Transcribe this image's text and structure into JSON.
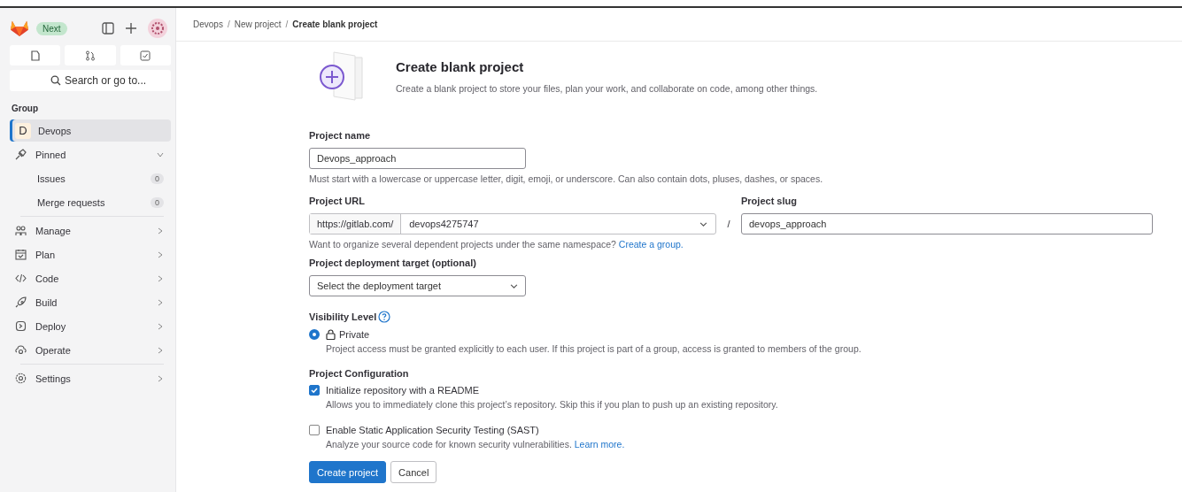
{
  "sidebar": {
    "badge": "Next",
    "search": {
      "placeholder": "Search or go to..."
    },
    "section": "Group",
    "group": {
      "avatar": "D",
      "label": "Devops",
      "selected": true
    },
    "pinned": {
      "label": "Pinned",
      "expanded": true,
      "children": [
        {
          "label": "Issues",
          "count": "0"
        },
        {
          "label": "Merge requests",
          "count": "0"
        }
      ]
    },
    "items": [
      {
        "label": "Manage",
        "selected": false
      },
      {
        "label": "Plan",
        "selected": false
      },
      {
        "label": "Code",
        "selected": false
      },
      {
        "label": "Build",
        "selected": false
      },
      {
        "label": "Deploy",
        "selected": false
      },
      {
        "label": "Operate",
        "selected": false
      },
      {
        "label": "Settings",
        "selected": false
      }
    ]
  },
  "breadcrumb": [
    "Devops",
    "New project",
    "Create blank project"
  ],
  "breadcrumb_separator": "/",
  "header": {
    "title": "Create blank project",
    "description": "Create a blank project to store your files, plan your work, and collaborate on code, among other things."
  },
  "form": {
    "name_label": "Project name",
    "name_value": "Devops_approach",
    "name_help": "Must start with a lowercase or uppercase letter, digit, emoji, or underscore. Can also contain dots, pluses, dashes, or spaces.",
    "url_label": "Project URL",
    "url_prefix": "https://gitlab.com/",
    "namespace": "devops4275747",
    "separator": "/",
    "slug_label": "Project slug",
    "slug_value": "devops_approach",
    "url_help": "Want to organize several dependent projects under the same namespace?",
    "url_link": "Create a group.",
    "target_label": "Project deployment target (optional)",
    "target_value": "Select the deployment target",
    "visibility_label": "Visibility Level",
    "visibility": [
      {
        "label": "Private",
        "description": "Project access must be granted explicitly to each user. If this project is part of a group, access is granted to members of the group.",
        "selected": true
      }
    ],
    "config_label": "Project Configuration",
    "options": [
      {
        "label": "Initialize repository with a README",
        "description": "Allows you to immediately clone this project’s repository. Skip this if you plan to push up an existing repository.",
        "checked": true
      },
      {
        "label": "Enable Static Application Security Testing (SAST)",
        "description": "Analyze your source code for known security vulnerabilities.",
        "link": "Learn more.",
        "checked": false
      }
    ]
  },
  "buttons": [
    {
      "label": "Create project",
      "kind": "primary"
    },
    {
      "label": "Cancel",
      "kind": "secondary"
    }
  ]
}
